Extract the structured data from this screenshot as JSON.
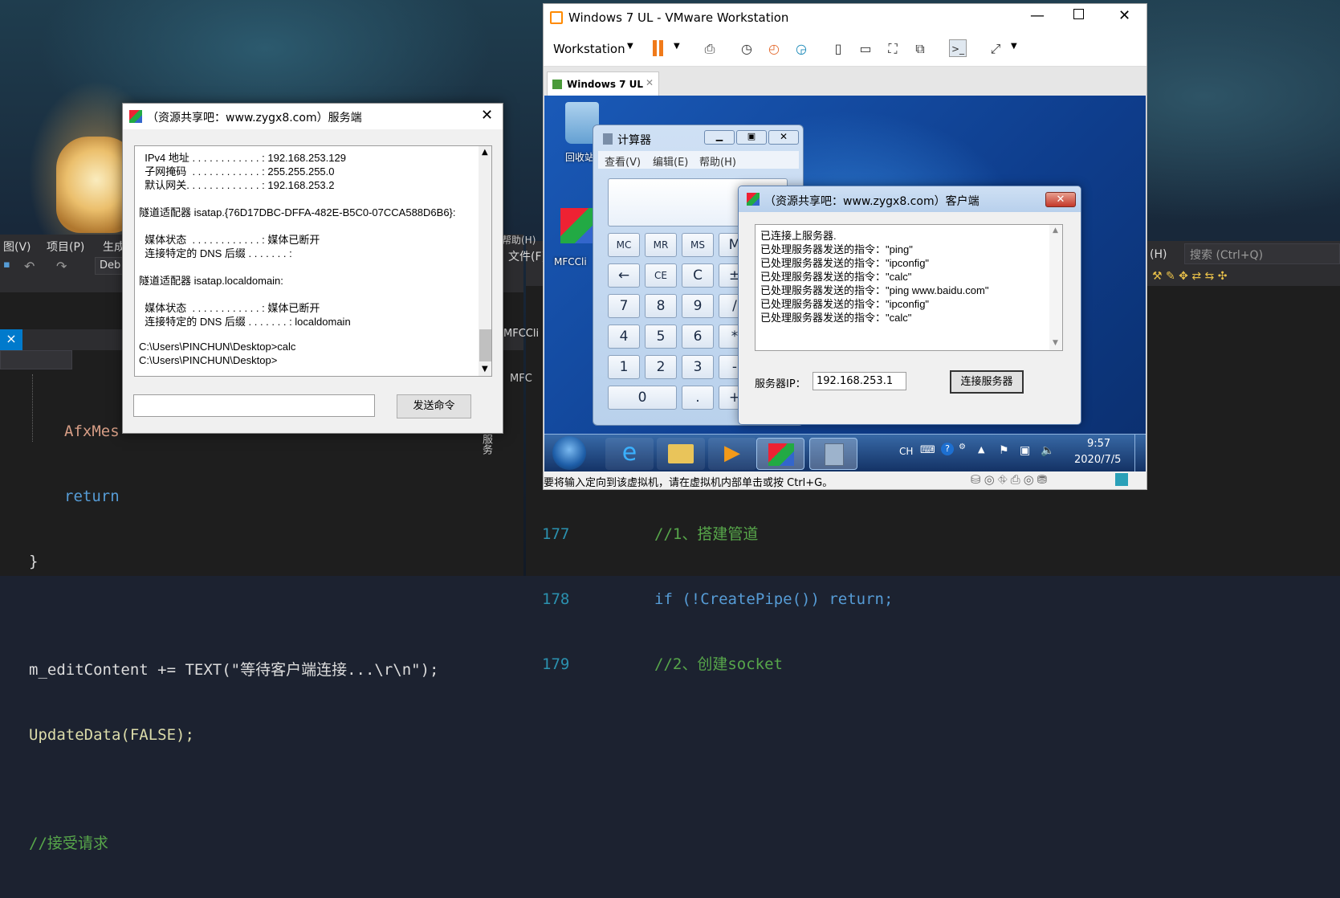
{
  "vs_left": {
    "menu": [
      "图(V)",
      "项目(P)",
      "生成"
    ],
    "config": "Deb",
    "code_lines": [
      {
        "t": "AfxMes",
        "c": "orange"
      },
      {
        "t": "return",
        "c": "blue"
      },
      {
        "t": "}",
        "c": ""
      },
      {
        "t": "",
        "c": ""
      },
      {
        "t": "m_editContent += TEXT(\"等待客户端连接...\\r\\n\");",
        "c": "orange"
      },
      {
        "t": "UpdateData(FALSE);",
        "c": "gold"
      },
      {
        "t": "",
        "c": ""
      },
      {
        "t": "//接受请求",
        "c": "green"
      }
    ]
  },
  "vs_right": {
    "menu_top": "帮助(H)",
    "file_menu": "文件(F)",
    "help_menu": "(H)",
    "search_placeholder": "搜索 (Ctrl+Q)",
    "tab_label": "MFCCli",
    "tab2": "MFC",
    "side_tab": "服务",
    "line_numbers": [
      "177",
      "178",
      "179"
    ],
    "code_lines": [
      "//1、搭建管道",
      "if (!CreatePipe()) return;",
      "//2、创建socket"
    ]
  },
  "server": {
    "title": "（资源共享吧：www.zygx8.com）服务端",
    "console": [
      "  IPv4 地址 . . . . . . . . . . . . : 192.168.253.129",
      "  子网掩码  . . . . . . . . . . . . : 255.255.255.0",
      "  默认网关. . . . . . . . . . . . . : 192.168.253.2",
      "",
      "隧道适配器 isatap.{76D17DBC-DFFA-482E-B5C0-07CCA588D6B6}:",
      "",
      "  媒体状态  . . . . . . . . . . . . : 媒体已断开",
      "  连接特定的 DNS 后缀 . . . . . . . :",
      "",
      "隧道适配器 isatap.localdomain:",
      "",
      "  媒体状态  . . . . . . . . . . . . : 媒体已断开",
      "  连接特定的 DNS 后缀 . . . . . . . : localdomain",
      "",
      "C:\\Users\\PINCHUN\\Desktop>calc",
      "C:\\Users\\PINCHUN\\Desktop>"
    ],
    "send_button": "发送命令",
    "close": "✕"
  },
  "vmware": {
    "title": "Windows 7 UL - VMware Workstation",
    "menu": "Workstation",
    "tab": "Windows 7 UL",
    "status": "要将输入定向到该虚拟机，请在虚拟机内部单击或按 Ctrl+G。",
    "recycle_label": "回收站",
    "mfc_label": "MFCCli"
  },
  "calculator": {
    "title": "计算器",
    "menu": [
      "查看(V)",
      "编辑(E)",
      "帮助(H)"
    ],
    "rows": [
      [
        "MC",
        "MR",
        "MS",
        "M"
      ],
      [
        "←",
        "CE",
        "C",
        "±"
      ],
      [
        "7",
        "8",
        "9",
        "/"
      ],
      [
        "4",
        "5",
        "6",
        "*"
      ],
      [
        "1",
        "2",
        "3",
        "-"
      ],
      [
        "0",
        ".",
        "+"
      ]
    ]
  },
  "client": {
    "title": "（资源共享吧：www.zygx8.com）客户端",
    "log": [
      "已连接上服务器.",
      "已处理服务器发送的指令：\"ping\"",
      "已处理服务器发送的指令：\"ipconfig\"",
      "已处理服务器发送的指令：\"calc\"",
      "已处理服务器发送的指令：\"ping www.baidu.com\"",
      "已处理服务器发送的指令：\"ipconfig\"",
      "已处理服务器发送的指令：\"calc\""
    ],
    "ip_label": "服务器IP：",
    "ip_value": "192.168.253.1",
    "connect_button": "连接服务器"
  },
  "taskbar": {
    "lang": "CH",
    "time": "9:57",
    "date": "2020/7/5"
  }
}
